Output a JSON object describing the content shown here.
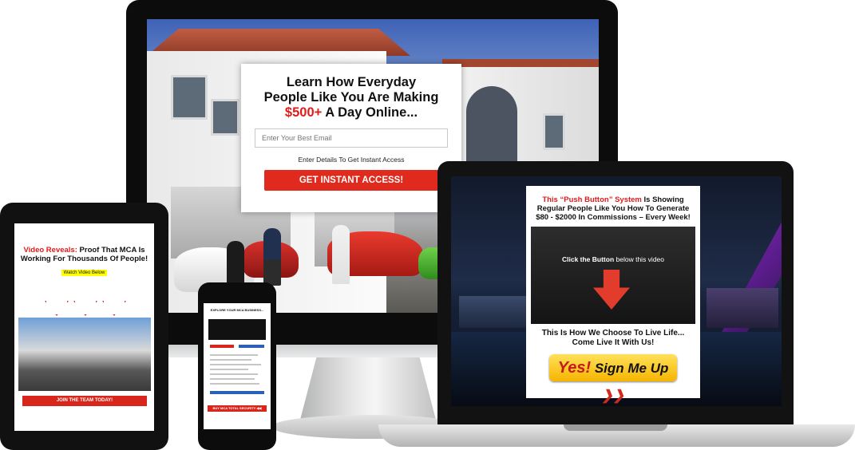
{
  "monitor": {
    "optin": {
      "headline_line1": "Learn How Everyday",
      "headline_line2": "People Like You Are Making",
      "headline_amount": "$500+",
      "headline_rest": " A Day Online...",
      "email_placeholder": "Enter Your Best Email",
      "note": "Enter Details To Get Instant Access",
      "button_label": "GET INSTANT ACCESS!"
    }
  },
  "laptop": {
    "headline_red": "This “Push Button” System",
    "headline_rest": " Is Showing Regular People Like You How To Generate $80 - $2000 In Commissions – Every Week!",
    "video_prefix": "Click the Button",
    "video_suffix": " below this video",
    "sub_line1": "This Is How We Choose To Live Life...",
    "sub_line2": "Come Live It With Us!",
    "button_pre": "Yes!",
    "button_label": " Sign Me Up",
    "button_chevrons": "❯❯",
    "colors": {
      "accent_red": "#e11b1b",
      "button_yellow": "#f5b400"
    }
  },
  "tablet": {
    "headline_red": "Video Reveals:",
    "headline_rest": " Proof That MCA Is Working For Thousands Of People!",
    "tag": "Watch Video Below",
    "button_label": "JOIN THE TEAM TODAY!"
  },
  "phone": {
    "headline": "EXPLORE YOUR MCA BUSINESS...",
    "button_label": "BUY MCA TOTAL SECURITY ◀◀"
  }
}
